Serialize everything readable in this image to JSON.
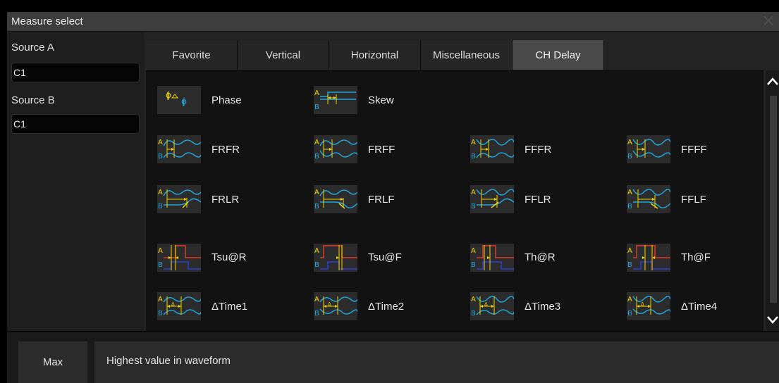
{
  "dialog": {
    "title": "Measure select",
    "close_icon": "close-icon"
  },
  "sources": {
    "a_label": "Source A",
    "a_value": "C1",
    "b_label": "Source B",
    "b_value": "C1"
  },
  "tabs": [
    {
      "label": "Favorite",
      "active": false
    },
    {
      "label": "Vertical",
      "active": false
    },
    {
      "label": "Horizontal",
      "active": false
    },
    {
      "label": "Miscellaneous",
      "active": false
    },
    {
      "label": "CH Delay",
      "active": true
    }
  ],
  "items": {
    "phase": "Phase",
    "skew": "Skew",
    "frfr": "FRFR",
    "frff": "FRFF",
    "fffr": "FFFR",
    "ffff": "FFFF",
    "frlr": "FRLR",
    "frlf": "FRLF",
    "fflr": "FFLR",
    "fflf": "FFLF",
    "tsu_r": "Tsu@R",
    "tsu_f": "Tsu@F",
    "th_r": "Th@R",
    "th_f": "Th@F",
    "dtime1": "ΔTime1",
    "dtime2": "ΔTime2",
    "dtime3": "ΔTime3",
    "dtime4": "ΔTime4",
    "letter_a": "A",
    "letter_b": "B",
    "phi": "ϕ"
  },
  "footer": {
    "selected": "Max",
    "description": "Highest value in waveform"
  },
  "colors": {
    "channel_a": "#f2d400",
    "channel_b": "#1fa3d8",
    "setup_red": "#e23a2a",
    "setup_blue": "#2b3fd6"
  },
  "icons": [
    "scroll-up-icon",
    "scroll-down-icon",
    "close-icon"
  ]
}
